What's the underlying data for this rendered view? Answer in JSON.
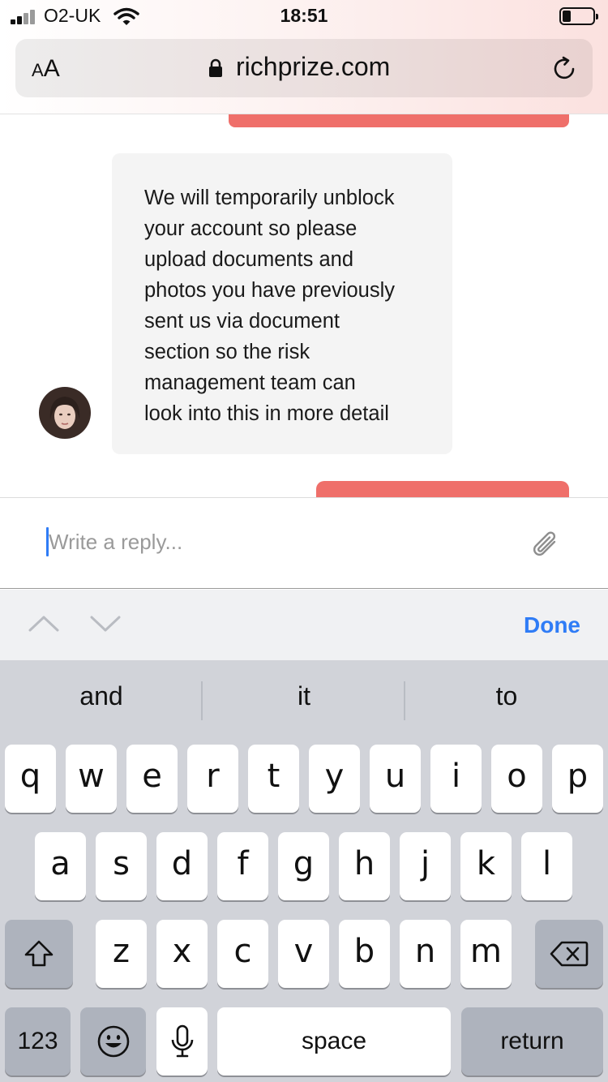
{
  "status_bar": {
    "carrier": "O2-UK",
    "time": "18:51"
  },
  "browser": {
    "text_size_small": "A",
    "text_size_big": "A",
    "url": "richprize.com"
  },
  "chat": {
    "message": "We will temporarily unblock\nyour account so please\nupload documents and\nphotos you have previously\nsent us via document\nsection so the risk\nmanagement team can\nlook into this in more detail"
  },
  "reply": {
    "placeholder": "Write a reply..."
  },
  "accessory": {
    "done_label": "Done"
  },
  "keyboard": {
    "suggestions": [
      "and",
      "it",
      "to"
    ],
    "row1": [
      "q",
      "w",
      "e",
      "r",
      "t",
      "y",
      "u",
      "i",
      "o",
      "p"
    ],
    "row2": [
      "a",
      "s",
      "d",
      "f",
      "g",
      "h",
      "j",
      "k",
      "l"
    ],
    "row3": [
      "z",
      "x",
      "c",
      "v",
      "b",
      "n",
      "m"
    ],
    "numbers_label": "123",
    "space_label": "space",
    "return_label": "return"
  },
  "colors": {
    "accent": "#2f7cf6",
    "brand_pink": "#ef6f6a",
    "keyboard_bg": "#d1d3d9"
  }
}
